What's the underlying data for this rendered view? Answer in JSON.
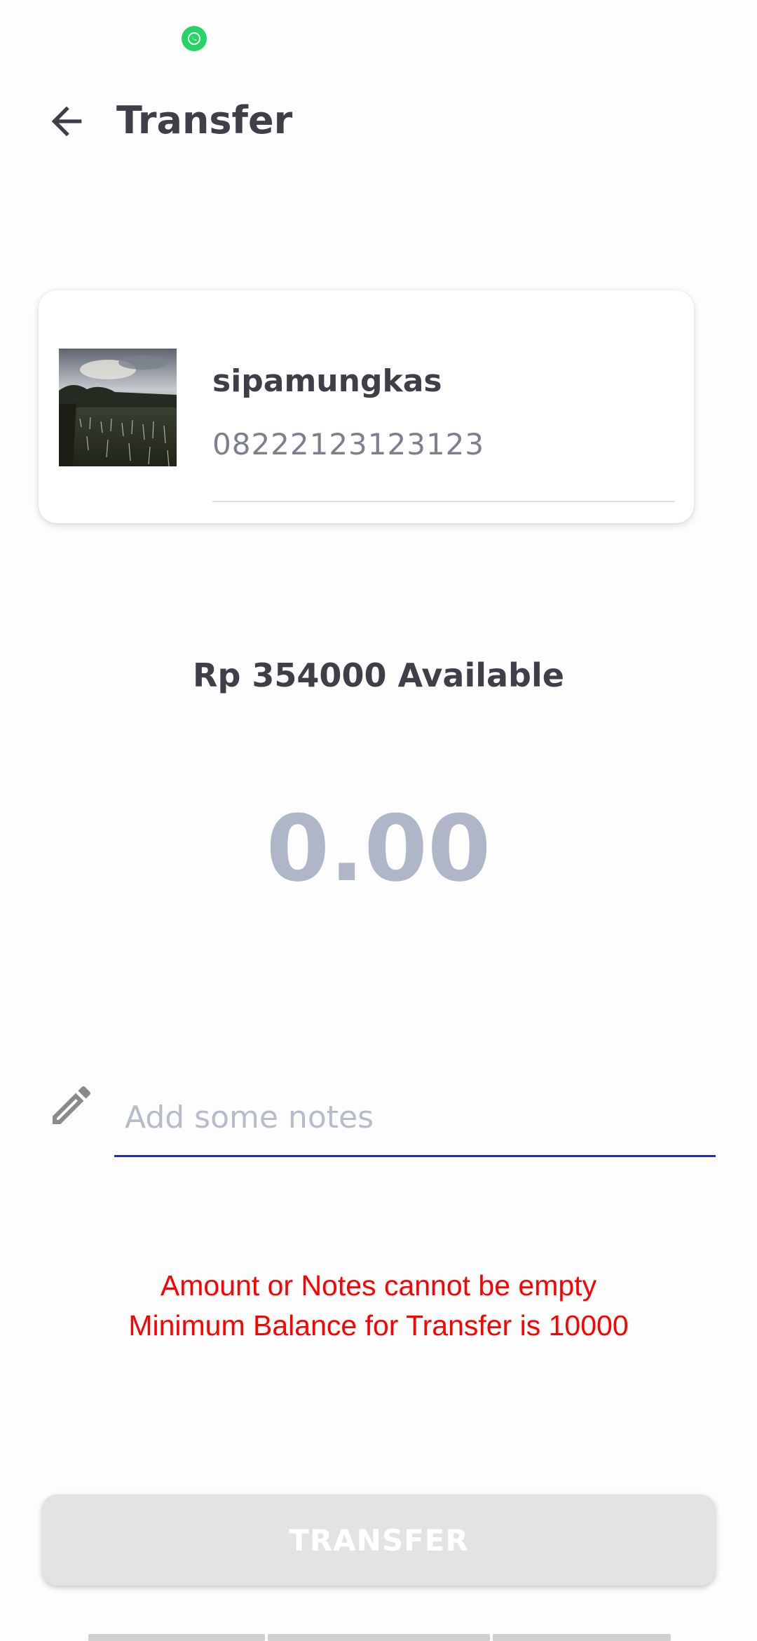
{
  "status_bar": {
    "notification_icon": "whatsapp-icon"
  },
  "header": {
    "back_icon": "arrow-back-icon",
    "title": "Transfer"
  },
  "recipient": {
    "avatar_icon": "landscape-photo-avatar",
    "name": "sipamungkas",
    "phone": "08222123123123"
  },
  "balance": {
    "text": "Rp 354000 Available"
  },
  "amount": {
    "value": "0.00"
  },
  "notes": {
    "icon": "pencil-icon",
    "placeholder": "Add some notes",
    "value": ""
  },
  "errors": [
    "Amount or Notes cannot be empty",
    "Minimum Balance for Transfer is 10000"
  ],
  "actions": {
    "transfer_label": "TRANSFER",
    "transfer_enabled": false
  },
  "colors": {
    "title_text": "#3f3f4a",
    "amount_text": "#aeb6c8",
    "error_text": "#ff0000",
    "input_underline": "#2424e0",
    "button_disabled_bg": "#e3e3e3",
    "whatsapp_green": "#25d366"
  }
}
